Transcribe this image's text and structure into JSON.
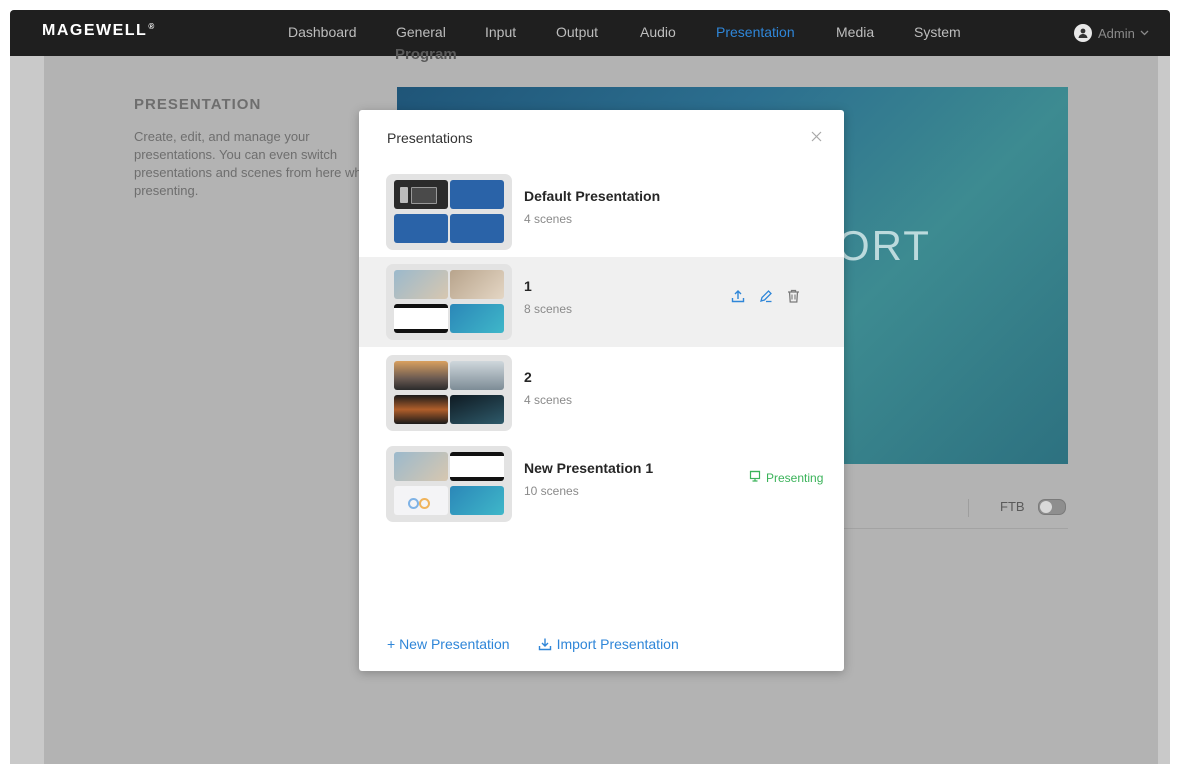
{
  "brand": {
    "logo": "MAGEWELL",
    "logo_mark": "®"
  },
  "nav": {
    "items": [
      {
        "label": "Dashboard"
      },
      {
        "label": "General"
      },
      {
        "label": "Input"
      },
      {
        "label": "Output"
      },
      {
        "label": "Audio"
      },
      {
        "label": "Presentation"
      },
      {
        "label": "Media"
      },
      {
        "label": "System"
      }
    ],
    "active": "Presentation",
    "active_color": "#2f86d8"
  },
  "user": {
    "name": "Admin"
  },
  "sidebar": {
    "title": "PRESENTATION",
    "description": "Create, edit, and manage your presentations. You can even switch presentations and scenes from here while presenting."
  },
  "program": {
    "label": "Program",
    "preview_text": "ORT",
    "ftb_label": "FTB",
    "ftb_on": false
  },
  "modal": {
    "title": "Presentations",
    "presentations": [
      {
        "name": "Default Presentation",
        "scenes": "4 scenes"
      },
      {
        "name": "1",
        "scenes": "8 scenes",
        "hovered": true
      },
      {
        "name": "2",
        "scenes": "4 scenes"
      },
      {
        "name": "New Presentation 1",
        "scenes": "10 scenes",
        "status": "Presenting"
      }
    ],
    "new_presentation_label": "+ New Presentation",
    "import_presentation_label": "Import Presentation",
    "presenting_color": "#3bb35a"
  }
}
